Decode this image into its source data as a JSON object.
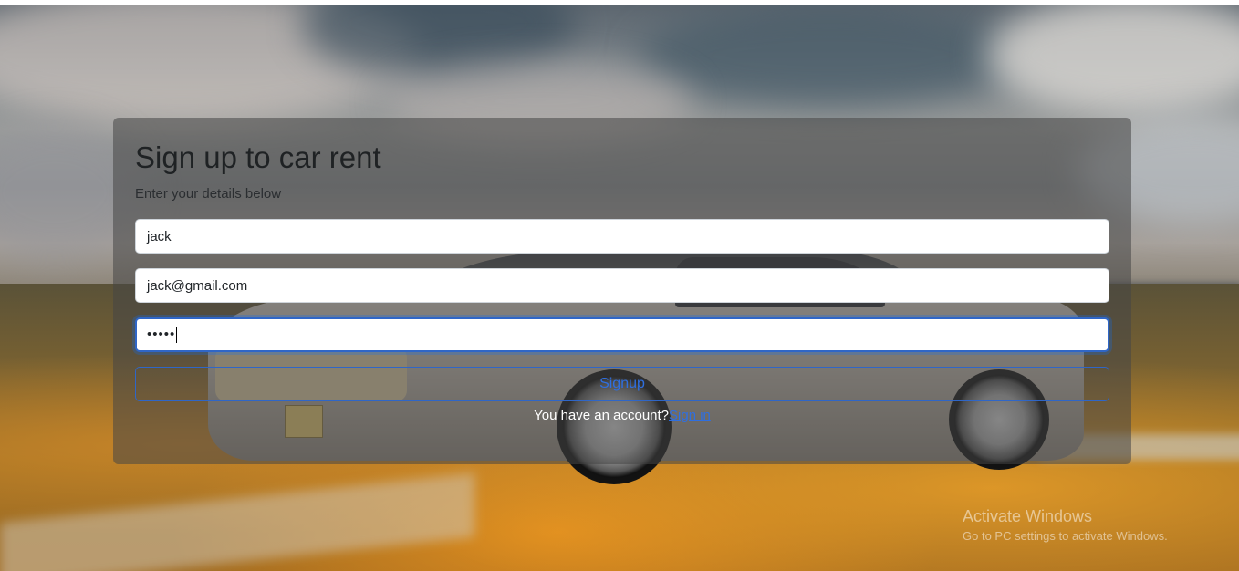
{
  "form": {
    "title": "Sign up to car rent",
    "subtitle": "Enter your details below",
    "name_value": "jack",
    "email_value": "jack@gmail.com",
    "password_masked": "•••••",
    "submit_label": "Signup",
    "account_prompt": "You have an account?",
    "signin_link": "Sign in"
  },
  "watermark": {
    "title": "Activate Windows",
    "subtitle": "Go to PC settings to activate Windows."
  },
  "colors": {
    "accent": "#2f6fe0",
    "card_overlay": "rgba(70,70,70,0.55)"
  }
}
